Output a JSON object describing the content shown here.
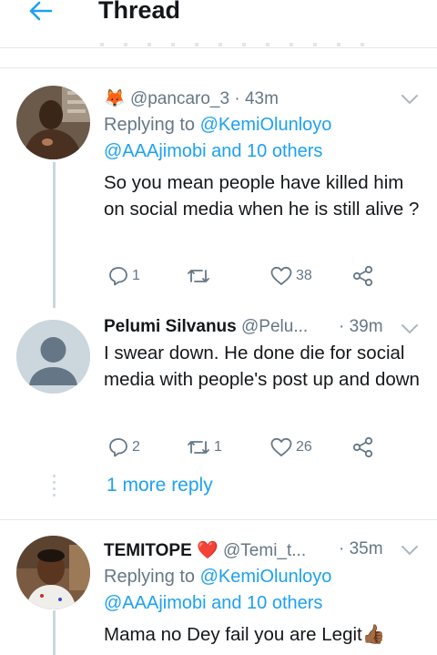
{
  "header": {
    "title": "Thread"
  },
  "tweets": [
    {
      "handle": "@pancaro_3",
      "sep": "·",
      "time": "43m",
      "emoji": "🦊",
      "replying_to": "Replying to",
      "mention1": "@KemiOlunloyo",
      "mention2": "@AAAjimobi and 10 others",
      "text": "So you mean people have killed him on social media when he is still alive ?",
      "replies": "1",
      "retweets": "",
      "likes": "38"
    },
    {
      "name": "Pelumi Silvanus",
      "handle": "@Pelu...",
      "sep": "·",
      "time": "39m",
      "text": "I swear down.  He done die for social media with people's post up and down",
      "replies": "2",
      "retweets": "1",
      "likes": "26"
    },
    {
      "name": "TEMITOPE",
      "heart": "❤️",
      "handle": "@Temi_t...",
      "sep": "·",
      "time": "35m",
      "replying_to": "Replying to",
      "mention1": "@KemiOlunloyo",
      "mention2": "@AAAjimobi and 10 others",
      "text": "Mama no Dey fail you are Legit👍🏾"
    }
  ],
  "more_reply": "1 more reply",
  "colors": {
    "accent": "#1da1f2",
    "muted": "#657786",
    "rule": "#e1e8ed"
  }
}
